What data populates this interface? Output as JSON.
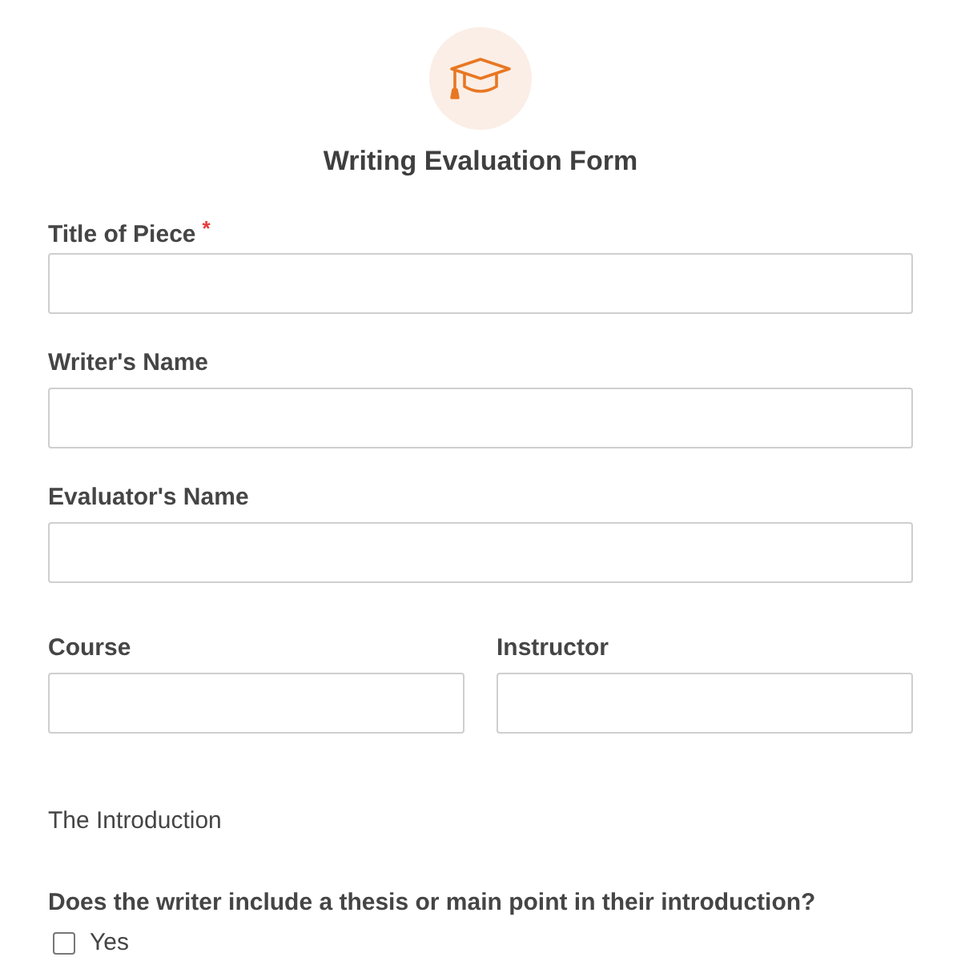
{
  "form": {
    "title": "Writing Evaluation Form"
  },
  "rows": [
    {
      "fields": [
        {
          "label": "Title of Piece",
          "required_mark": "*"
        }
      ]
    },
    {
      "fields": [
        {
          "label": "Writer's Name"
        }
      ]
    },
    {
      "fields": [
        {
          "label": "Evaluator's Name"
        }
      ]
    },
    {
      "fields": [
        {
          "label": "Course"
        },
        {
          "label": "Instructor"
        }
      ]
    }
  ],
  "section": {
    "title": "The Introduction"
  },
  "question": {
    "text": "Does the writer include a thesis or main point in their introduction?",
    "options": [
      {
        "label": "Yes",
        "checked": false
      }
    ]
  }
}
